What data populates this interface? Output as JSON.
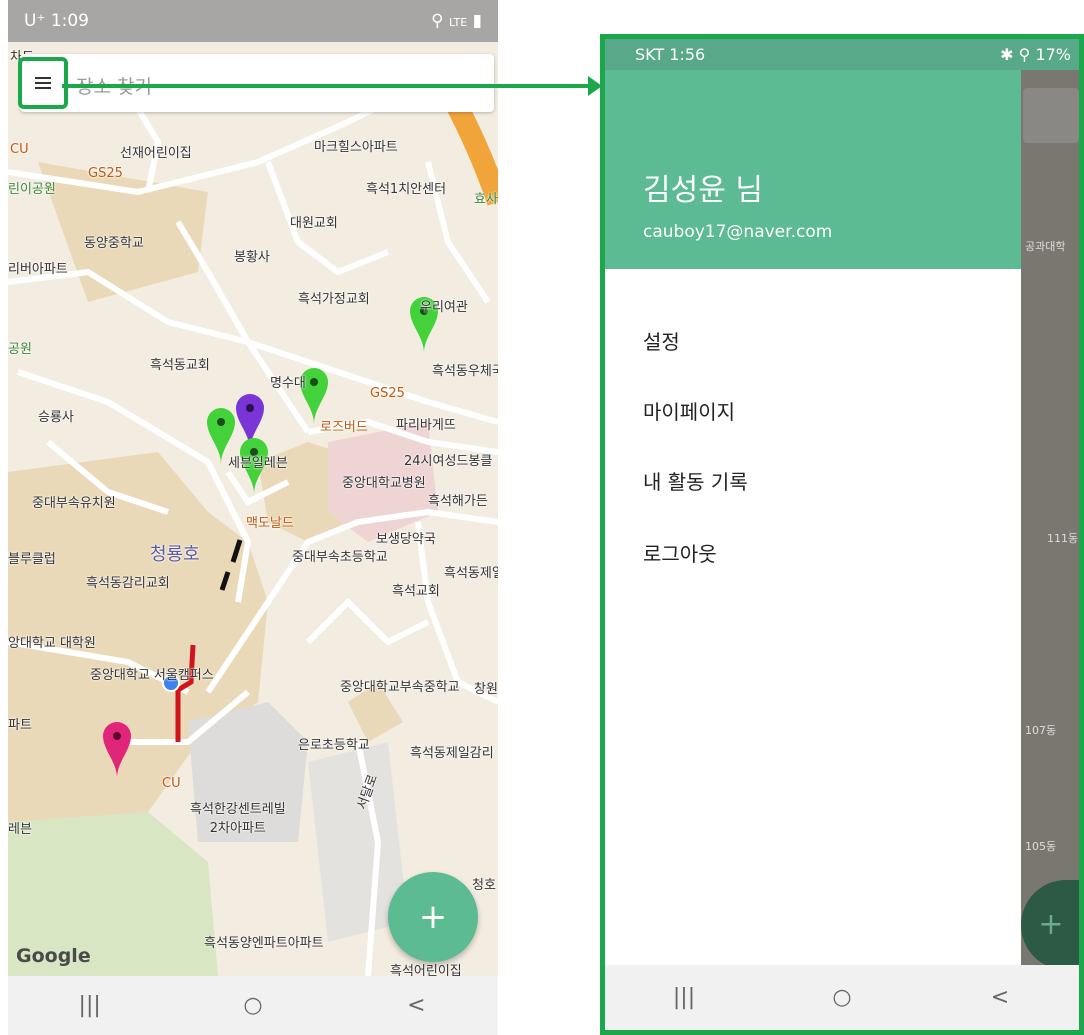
{
  "left_screen": {
    "status_bar": {
      "left": "U⁺ 1:09",
      "right": "LTE"
    },
    "search": {
      "placeholder": "장소 찾기"
    },
    "map_labels": {
      "l01": "차도",
      "l02": "CU",
      "l03": "선재어린이집",
      "l04": "GS25",
      "l05": "마크힐스아파트",
      "l06": "흑석1치안센터",
      "l07": "효사",
      "l08": "린이공원",
      "l09": "대원교회",
      "l10": "동양중학교",
      "l11": "봉황사",
      "l12": "리버아파트",
      "l13": "흑석가정교회",
      "l14": "우리여관",
      "l15": "공원",
      "l16": "흑석동교회",
      "l17": "명수대",
      "l18": "흑석동우체국",
      "l19": "GS25",
      "l20": "승룡사",
      "l21": "로즈버드",
      "l22": "파리바게뜨",
      "l23": "세븐일레븐",
      "l24": "24시여성드봉클",
      "l25": "중앙대학교병원",
      "l26": "중대부속유치원",
      "l27": "흑석해가든",
      "l28": "맥도날드",
      "l29": "보생당약국",
      "l30": "블루클럽",
      "l31": "청룡호",
      "l32": "중대부속초등학교",
      "l33": "흑석동제일",
      "l34": "흑석동감리교회",
      "l35": "흑석교회",
      "l36": "앙대학교 대학원",
      "l37": "중앙대학교 서울캠퍼스",
      "l38": "중앙대학교부속중학교",
      "l39": "창원",
      "l40": "파트",
      "l41": "은로초등학교",
      "l42": "흑석동제일감리",
      "l43": "CU",
      "l44": "흑석한강센트레빌\n2차아파트",
      "l45": "레븐",
      "l46": "청호",
      "l47": "흑석동양엔파트아파트",
      "l48": "흑석어린이집",
      "l49": "서달로"
    },
    "fab_icon": "+",
    "google_logo": "Google",
    "nav": {
      "recents": "|||",
      "home": "○",
      "back": "<"
    }
  },
  "right_screen": {
    "status_bar": {
      "left": "SKT 1:56",
      "right": "17%"
    },
    "drawer": {
      "user_name": "김성윤 님",
      "user_email": "cauboy17@naver.com",
      "items": [
        "설정",
        "마이페이지",
        "내 활동 기록",
        "로그아웃"
      ]
    },
    "behind_labels": {
      "a": "공과대학",
      "b": "111동",
      "c": "107동",
      "d": "105동"
    },
    "fab_icon": "+",
    "nav": {
      "recents": "|||",
      "home": "○",
      "back": "<"
    }
  },
  "colors": {
    "accent_green": "#5cbb93",
    "highlight_green": "#1aa84a",
    "pin_green": "#43d23a",
    "pin_purple": "#7b35d6",
    "pin_pink": "#e0257a",
    "route_red": "#d0141c"
  },
  "icons": [
    "hamburger-menu-icon",
    "plus-icon",
    "map-pin-icon",
    "location-dot-icon"
  ]
}
